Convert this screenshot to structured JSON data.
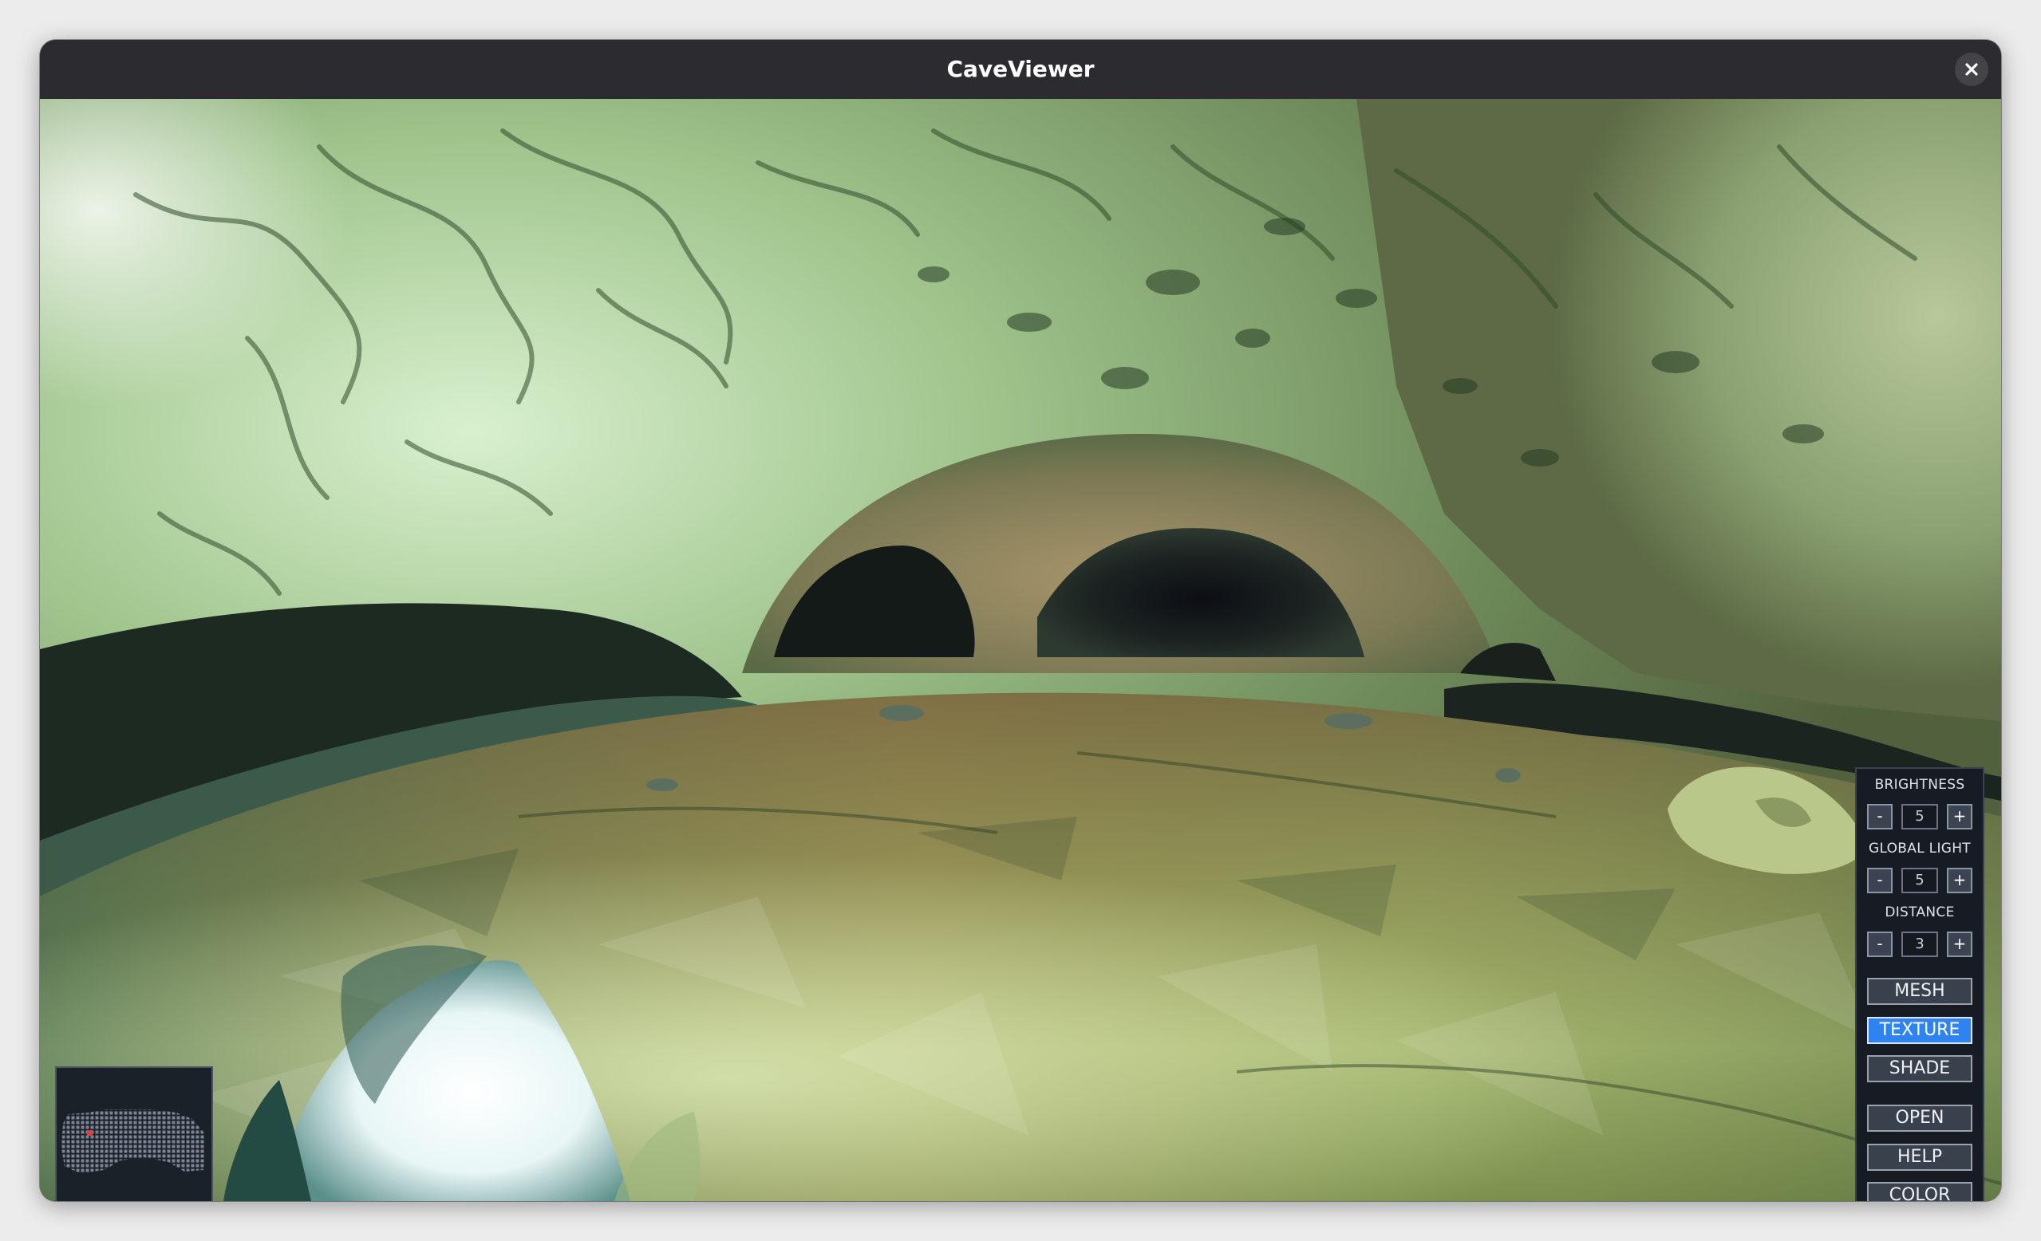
{
  "window": {
    "title": "CaveViewer",
    "close_icon": "close-icon"
  },
  "controls": {
    "brightness": {
      "label": "BRIGHTNESS",
      "value": "5",
      "minus": "-",
      "plus": "+"
    },
    "global_light": {
      "label": "GLOBAL LIGHT",
      "value": "5",
      "minus": "-",
      "plus": "+"
    },
    "distance": {
      "label": "DISTANCE",
      "value": "3",
      "minus": "-",
      "plus": "+"
    },
    "modes": [
      {
        "label": "MESH",
        "active": false
      },
      {
        "label": "TEXTURE",
        "active": true
      },
      {
        "label": "SHADE",
        "active": false
      }
    ],
    "actions": [
      {
        "label": "OPEN"
      },
      {
        "label": "HELP"
      },
      {
        "label": "COLOR"
      }
    ]
  },
  "minimap": {
    "marker_color": "#e23b3b"
  },
  "colors": {
    "accent": "#2f83f0",
    "titlebar": "#2c2c30",
    "panel_bg": "#161b24"
  }
}
